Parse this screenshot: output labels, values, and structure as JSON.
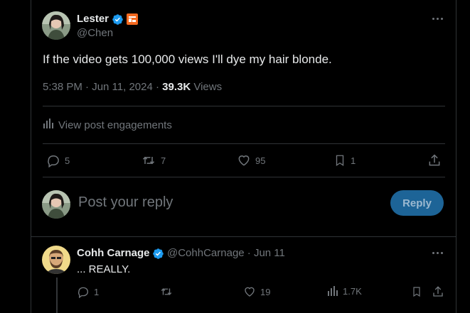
{
  "post": {
    "author_name": "Lester",
    "author_handle": "@Chen",
    "text": "If the video gets 100,000 views I'll dye my hair blonde.",
    "time": "5:38 PM · Jun 11, 2024 · ",
    "views_count": "39.3K",
    "views_label": " Views",
    "engagements_label": "View post engagements",
    "replies": "5",
    "reposts": "7",
    "likes": "95",
    "bookmarks": "1"
  },
  "composer": {
    "placeholder": "Post your reply",
    "button_label": "Reply"
  },
  "reply": {
    "author_name": "Cohh Carnage",
    "author_handle": "@CohhCarnage · Jun 11",
    "text": "... REALLY.",
    "replies": "1",
    "likes": "19",
    "views": "1.7K"
  },
  "colors": {
    "verified": "#1d9bf0",
    "accent": "#1d9bf0",
    "reply_button": "#1d6497",
    "orange_badge": "#f4691f"
  },
  "icons": [
    "verified-icon",
    "orange-badge-icon",
    "more-icon",
    "analytics-icon",
    "reply-icon",
    "repost-icon",
    "like-icon",
    "bookmark-icon",
    "share-icon"
  ]
}
